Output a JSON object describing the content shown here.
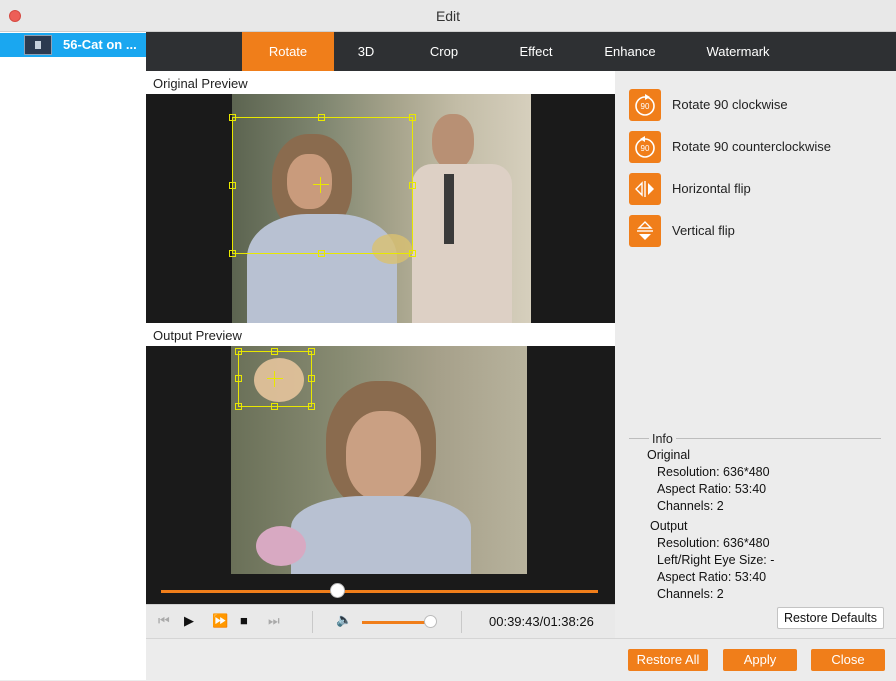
{
  "window": {
    "title": "Edit"
  },
  "sidebar": {
    "items": [
      {
        "label": "56-Cat on ..."
      }
    ]
  },
  "tabs": [
    {
      "label": "Rotate",
      "active": true
    },
    {
      "label": "3D"
    },
    {
      "label": "Crop"
    },
    {
      "label": "Effect"
    },
    {
      "label": "Enhance"
    },
    {
      "label": "Watermark"
    }
  ],
  "preview": {
    "original_title": "Original Preview",
    "output_title": "Output Preview"
  },
  "player": {
    "seek_progress": 0.4,
    "volume_level": 0.9,
    "time": "00:39:43/01:38:26"
  },
  "rotate_actions": [
    {
      "label": "Rotate 90 clockwise",
      "icon": "rotate-clockwise-icon"
    },
    {
      "label": "Rotate 90 counterclockwise",
      "icon": "rotate-counterclockwise-icon"
    },
    {
      "label": "Horizontal flip",
      "icon": "horizontal-flip-icon"
    },
    {
      "label": "Vertical flip",
      "icon": "vertical-flip-icon"
    }
  ],
  "info": {
    "title": "Info",
    "original": {
      "heading": "Original",
      "resolution": "Resolution: 636*480",
      "aspect": "Aspect Ratio: 53:40",
      "channels": "Channels: 2"
    },
    "output": {
      "heading": "Output",
      "resolution": "Resolution: 636*480",
      "eye_size": "Left/Right Eye Size: -",
      "aspect": "Aspect Ratio: 53:40",
      "channels": "Channels: 2"
    }
  },
  "buttons": {
    "restore_defaults": "Restore Defaults",
    "restore_all": "Restore All",
    "apply": "Apply",
    "close": "Close"
  },
  "colors": {
    "accent": "#f07e1a",
    "selection": "#1aa7f0",
    "crop_box": "#e8e800"
  }
}
